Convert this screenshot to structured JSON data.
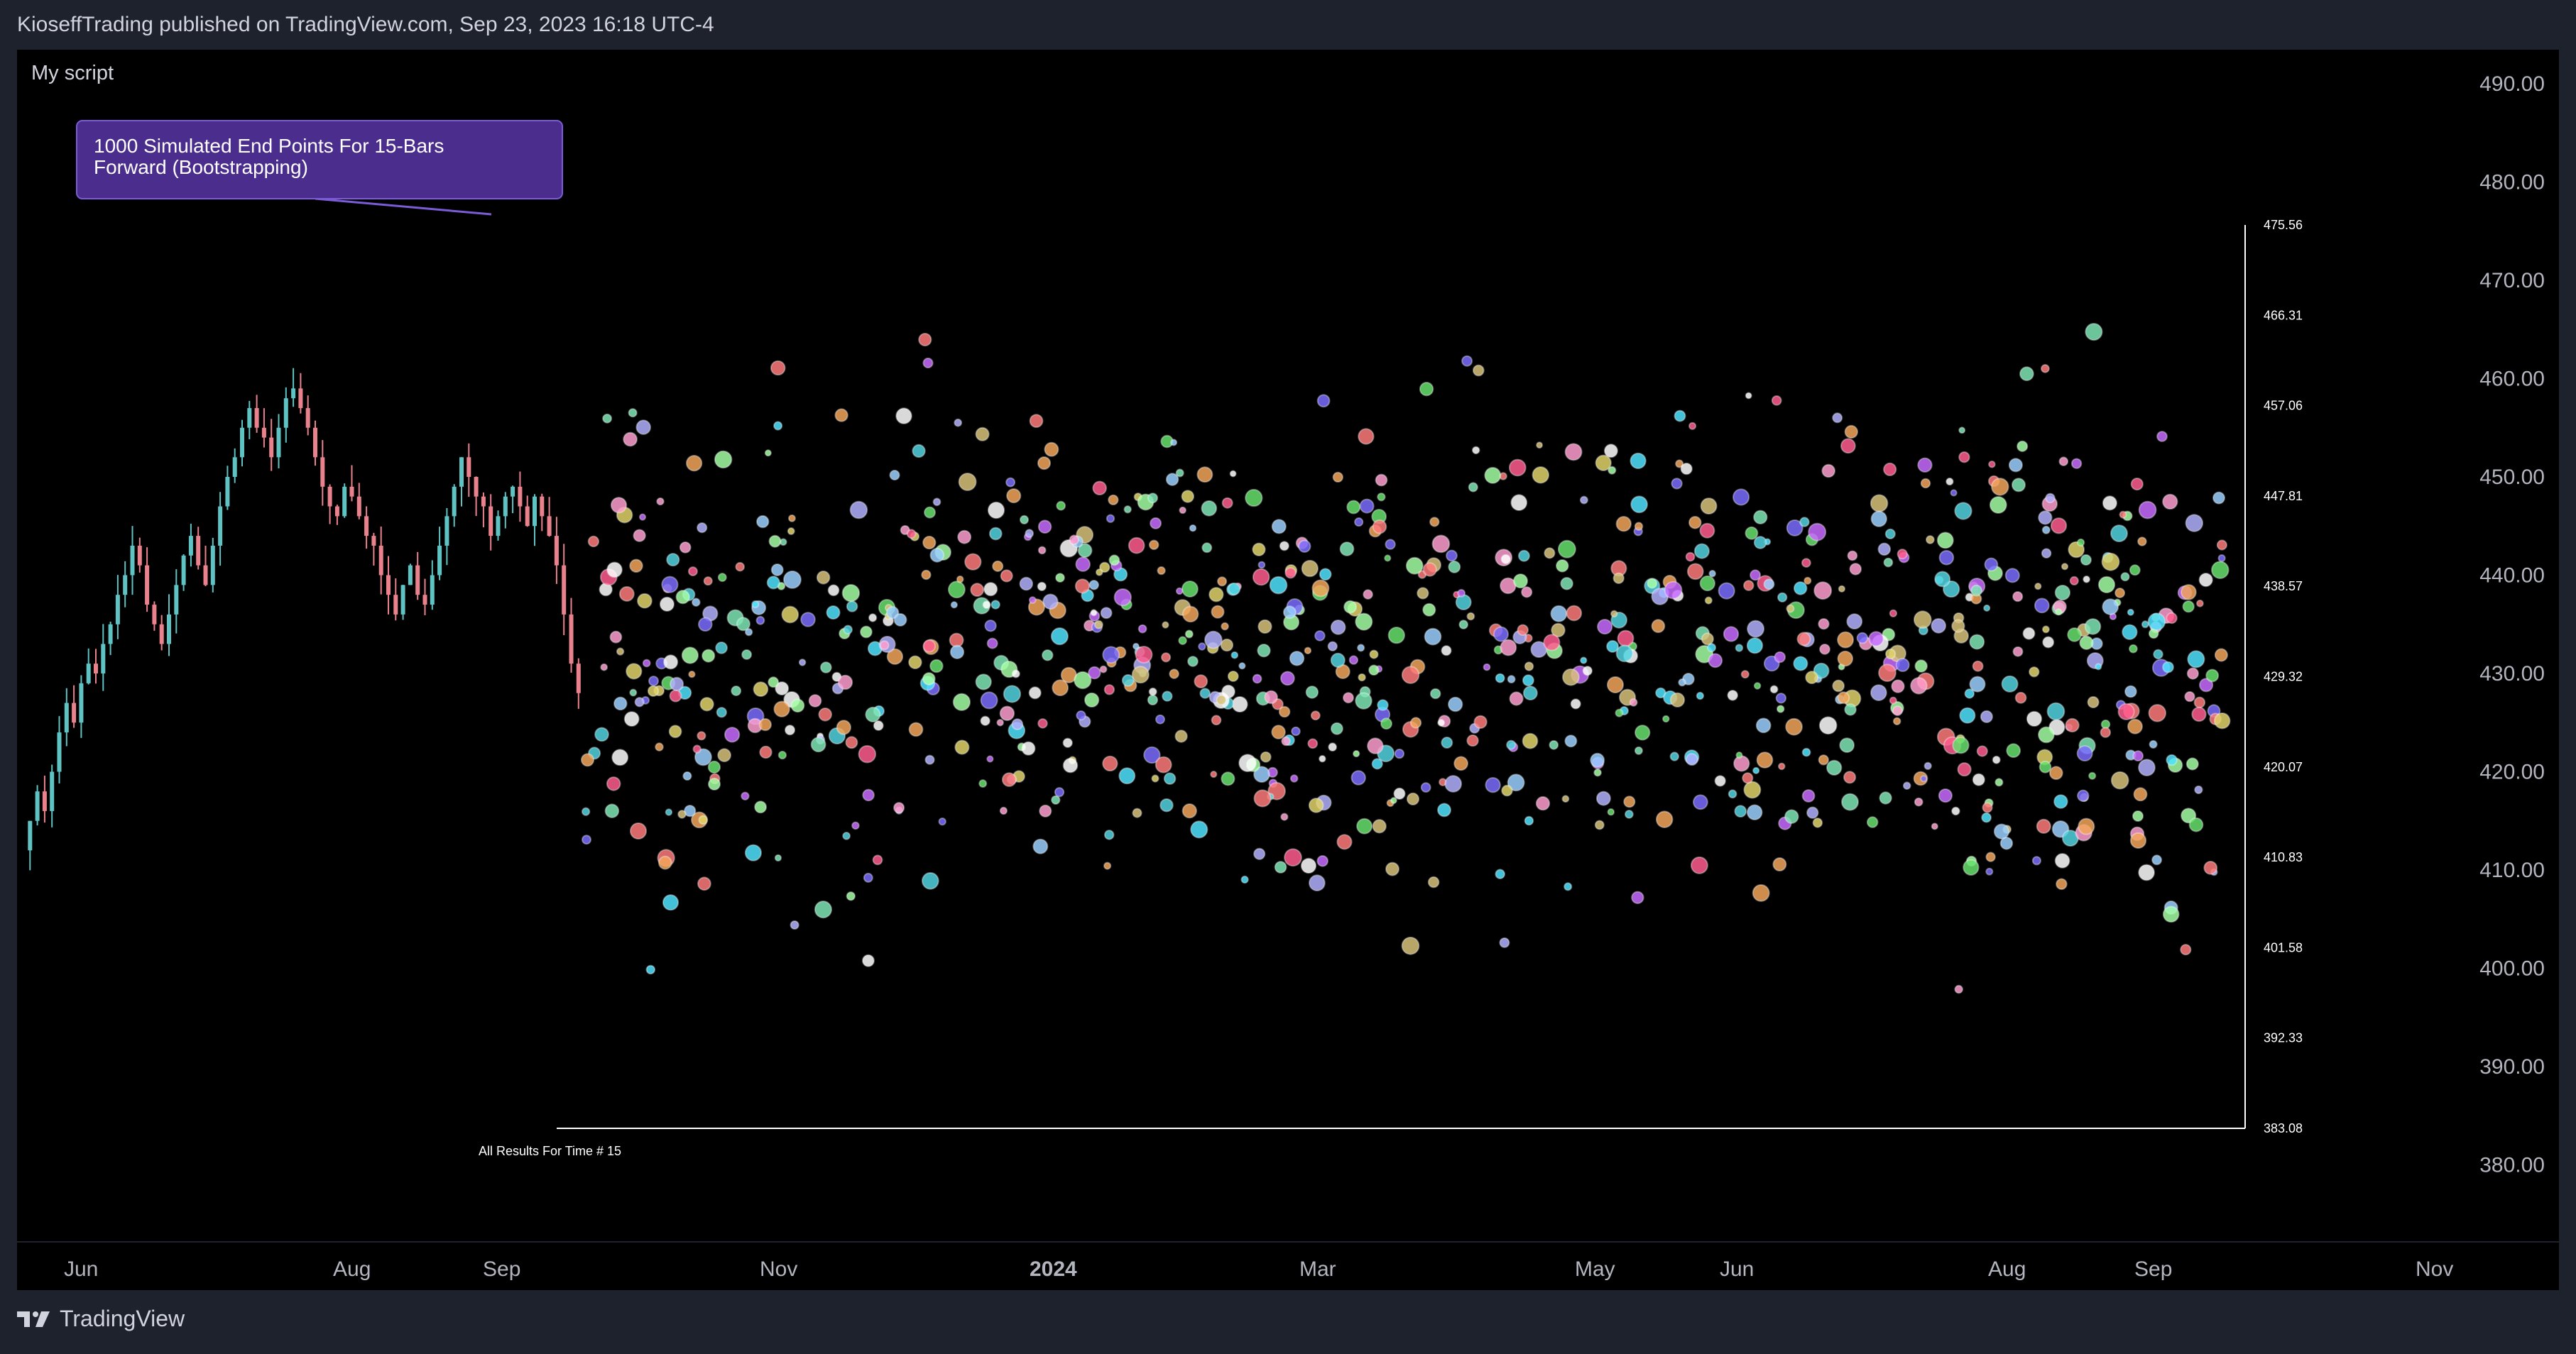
{
  "header": {
    "published_text": "KioseffTrading published on TradingView.com, Sep 23, 2023 16:18 UTC-4"
  },
  "footer": {
    "brand": "TradingView"
  },
  "chart_data": {
    "type": "scatter",
    "indicator_name": "My script",
    "annotation": "1000 Simulated End Points For 15-Bars Forward (Bootstrapping)",
    "caption": "All Results For Time # 15",
    "price_axis_ticks": [
      "490.00",
      "480.00",
      "470.00",
      "460.00",
      "450.00",
      "440.00",
      "430.00",
      "420.00",
      "410.00",
      "400.00",
      "390.00",
      "380.00"
    ],
    "price_axis_range": [
      375,
      492
    ],
    "inner_scale_ticks": [
      "475.56",
      "466.31",
      "457.06",
      "447.81",
      "438.57",
      "429.32",
      "420.07",
      "410.83",
      "401.58",
      "392.33",
      "383.08"
    ],
    "time_axis_labels": [
      {
        "label": "Jun",
        "bold": false
      },
      {
        "label": "Aug",
        "bold": false
      },
      {
        "label": "Sep",
        "bold": false
      },
      {
        "label": "Nov",
        "bold": false
      },
      {
        "label": "2024",
        "bold": true
      },
      {
        "label": "Mar",
        "bold": false
      },
      {
        "label": "May",
        "bold": false
      },
      {
        "label": "Jun",
        "bold": false
      },
      {
        "label": "Aug",
        "bold": false
      },
      {
        "label": "Sep",
        "bold": false
      },
      {
        "label": "Nov",
        "bold": false
      }
    ],
    "candles_close_path": [
      412,
      415,
      418,
      416,
      420,
      424,
      427,
      425,
      429,
      431,
      430,
      433,
      435,
      438,
      440,
      443,
      441,
      437,
      435,
      433,
      436,
      439,
      442,
      444,
      441,
      439,
      443,
      447,
      450,
      452,
      455,
      457,
      455,
      454,
      452,
      455,
      458,
      459,
      457,
      455,
      452,
      449,
      447,
      446,
      449,
      448,
      446,
      444,
      443,
      440,
      438,
      436,
      439,
      441,
      438,
      437,
      440,
      443,
      446,
      449,
      452,
      450,
      448,
      447,
      444,
      446,
      448,
      449,
      447,
      445,
      448,
      446,
      444,
      441,
      436,
      431,
      428
    ],
    "simulation": {
      "count": 1000,
      "bars_forward": 15,
      "y_min": 383.08,
      "y_max": 475.56,
      "center": 432
    },
    "colors": {
      "background": "#000000",
      "panel": "#1e222d",
      "up_candle": "#5fc3c3",
      "down_candle": "#e9828c",
      "label_bg": "#4a2d8c",
      "label_border": "#7b5cd6",
      "axis_text": "#b2b5be",
      "white": "#ffffff"
    }
  }
}
